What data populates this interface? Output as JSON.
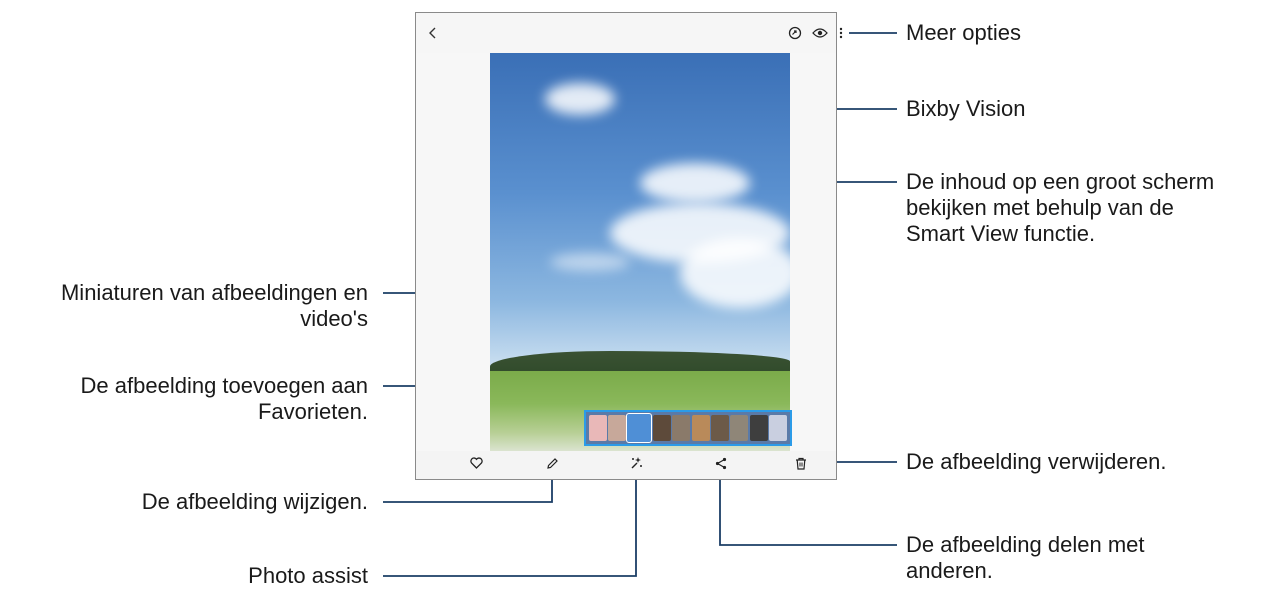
{
  "annotations": {
    "more_options": "Meer opties",
    "bixby_vision": "Bixby Vision",
    "smart_view": [
      "De inhoud op een groot scherm",
      "bekijken met behulp van de",
      "Smart View functie."
    ],
    "thumbnails": [
      "Miniaturen van afbeeldingen en",
      "video's"
    ],
    "favorites": [
      "De afbeelding toevoegen aan",
      "Favorieten."
    ],
    "delete": "De afbeelding verwijderen.",
    "edit": "De afbeelding wijzigen.",
    "share": [
      "De afbeelding delen met",
      "anderen."
    ],
    "photo_assist": "Photo assist"
  },
  "icons": {
    "back": "back-arrow-icon",
    "smart_view": "smart-view-icon",
    "bixby_vision": "eye-icon",
    "more_options": "more-vertical-icon",
    "favorite": "heart-icon",
    "edit": "pencil-icon",
    "photo_assist": "sparkle-icon",
    "share": "share-icon",
    "delete": "trash-icon"
  },
  "thumbnail_colors": [
    "#e9b8b8",
    "#c7a89a",
    "#4f8fd6",
    "#5d4a3a",
    "#8a7a6a",
    "#b98a5a",
    "#6c5a48",
    "#8f8678",
    "#3e3e3e",
    "#c9cfe0"
  ],
  "colors": {
    "leader_line": "#1b3e66",
    "highlight": "#2b9be8"
  }
}
